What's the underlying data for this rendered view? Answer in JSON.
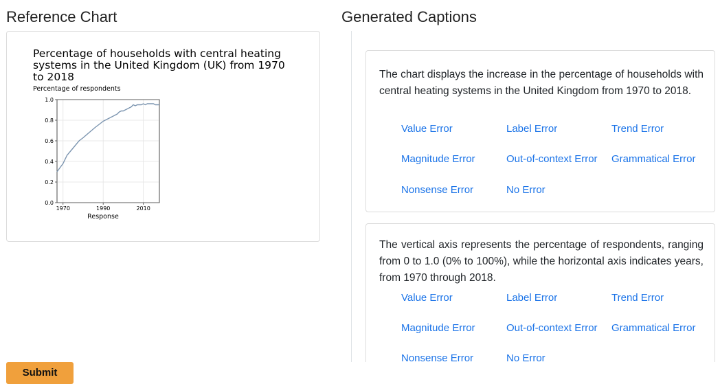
{
  "reference": {
    "title": "Reference Chart"
  },
  "generated": {
    "title": "Generated Captions"
  },
  "chart_data": {
    "type": "line",
    "title_lines": [
      "Percentage of households with central heating",
      "systems in the United Kingdom (UK) from 1970",
      "to 2018"
    ],
    "title": "Percentage of households with central heating systems in the United Kingdom (UK) from 1970 to 2018",
    "ylabel": "Percentage of respondents",
    "xlabel": "Response",
    "xlim": [
      1967,
      2018
    ],
    "ylim": [
      0,
      1.0
    ],
    "yticks": [
      "0.0",
      "0.2",
      "0.4",
      "0.6",
      "0.8",
      "1.0"
    ],
    "xticks": [
      "1970",
      "1990",
      "2010"
    ],
    "grid": true,
    "series": [
      {
        "color": "#7c95b0",
        "x": [
          1967,
          1970,
          1972,
          1975,
          1978,
          1980,
          1983,
          1986,
          1988,
          1990,
          1992,
          1994,
          1995,
          1996,
          1997,
          1998,
          1999,
          2000,
          2001,
          2002,
          2003,
          2004,
          2005,
          2006,
          2007,
          2008,
          2009,
          2010,
          2011,
          2012,
          2013,
          2014,
          2015,
          2016,
          2017,
          2018
        ],
        "y": [
          0.3,
          0.38,
          0.46,
          0.53,
          0.6,
          0.63,
          0.68,
          0.73,
          0.76,
          0.79,
          0.81,
          0.83,
          0.84,
          0.85,
          0.86,
          0.88,
          0.89,
          0.89,
          0.9,
          0.91,
          0.92,
          0.93,
          0.95,
          0.94,
          0.95,
          0.95,
          0.95,
          0.96,
          0.95,
          0.96,
          0.96,
          0.96,
          0.96,
          0.95,
          0.95,
          0.95
        ]
      }
    ]
  },
  "captions": [
    {
      "text": "The chart displays the increase in the percentage of households with central heating systems in the United Kingdom from 1970 to 2018.",
      "errors": [
        "Value Error",
        "Label Error",
        "Trend Error",
        "Magnitude Error",
        "Out-of-context Error",
        "Grammatical Error",
        "Nonsense Error",
        "No Error"
      ]
    },
    {
      "text": "The vertical axis represents the percentage of respondents, ranging from 0 to 1.0 (0% to 100%), while the horizontal axis indicates years, from 1970 through 2018.",
      "errors": [
        "Value Error",
        "Label Error",
        "Trend Error",
        "Magnitude Error",
        "Out-of-context Error",
        "Grammatical Error",
        "Nonsense Error",
        "No Error"
      ]
    }
  ],
  "submit_label": "Submit",
  "colors": {
    "link": "#1a73e8",
    "submit": "#f0a03c",
    "line": "#7c95b0"
  }
}
